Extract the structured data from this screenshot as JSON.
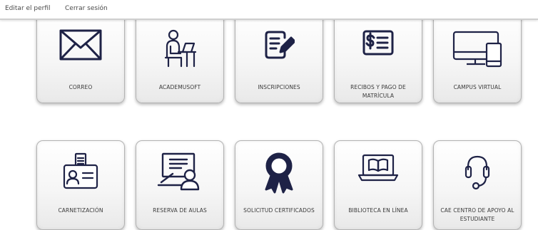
{
  "header": {
    "edit_profile": "Editar el perfil",
    "logout": "Cerrar sesión"
  },
  "colors": {
    "icon": "#1e2246",
    "card_border": "#b3b3b3",
    "label_text": "#3a3a3a"
  },
  "tiles": [
    {
      "label": "CORREO",
      "icon": "envelope-icon"
    },
    {
      "label": "ACADEMUSOFT",
      "icon": "person-at-desk-icon"
    },
    {
      "label": "INSCRIPCIONES",
      "icon": "form-pencil-icon"
    },
    {
      "label": "RECIBOS Y PAGO DE MATRÍCULA",
      "icon": "receipt-dollar-icon"
    },
    {
      "label": "CAMPUS VIRTUAL",
      "icon": "monitor-phone-icon"
    },
    {
      "label": "CARNETIZACIÓN",
      "icon": "id-card-icon"
    },
    {
      "label": "RESERVA DE AULAS",
      "icon": "classroom-board-icon"
    },
    {
      "label": "SOLICITUD CERTIFICADOS",
      "icon": "award-ribbon-icon"
    },
    {
      "label": "BIBLIOTECA EN LÍNEA",
      "icon": "laptop-book-icon"
    },
    {
      "label": "CAE CENTRO DE APOYO AL ESTUDIANTE",
      "icon": "headset-icon"
    }
  ]
}
